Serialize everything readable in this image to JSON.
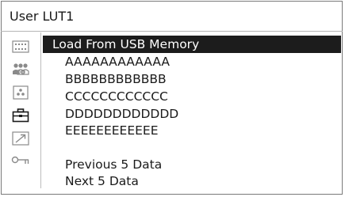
{
  "window": {
    "title": "User LUT1"
  },
  "sidebar": {
    "items": [
      {
        "icon": "display-grid-icon"
      },
      {
        "icon": "people-icon"
      },
      {
        "icon": "camera-icon"
      },
      {
        "icon": "briefcase-icon"
      },
      {
        "icon": "arrow-up-right-icon"
      },
      {
        "icon": "key-icon"
      }
    ]
  },
  "menu": {
    "selected_index": 0,
    "items": [
      {
        "label": "Load From USB Memory"
      },
      {
        "label": "AAAAAAAAAAAA"
      },
      {
        "label": "BBBBBBBBBBBB"
      },
      {
        "label": "CCCCCCCCCCCC"
      },
      {
        "label": "DDDDDDDDDDDD"
      },
      {
        "label": "EEEEEEEEEEEE"
      },
      {
        "label": "Previous 5 Data"
      },
      {
        "label": "Next 5 Data"
      }
    ]
  },
  "colors": {
    "highlight_bg": "#1c1c1c",
    "highlight_text": "#ffffff",
    "text": "#1a1a1a",
    "icon": "#8a8a8a"
  }
}
